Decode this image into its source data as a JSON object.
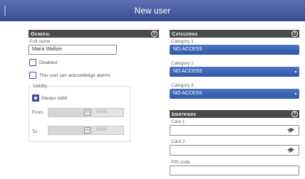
{
  "window": {
    "title": "New user"
  },
  "general": {
    "header": "General",
    "full_name_label": "Full name",
    "full_name_value": "Maria Wallser",
    "disabled_label": "Disabled",
    "disabled_checked": false,
    "acknowledge_label": "This user can acknowledge alarms",
    "acknowledge_checked": false,
    "validity": {
      "label": "Validity",
      "always_valid_label": "Always valid",
      "always_valid_checked": true,
      "from_label": "From",
      "from_time": "00:00",
      "to_label": "To",
      "to_time": "00:00"
    }
  },
  "categories": {
    "header": "Categories",
    "items": [
      {
        "label": "Category 1",
        "value": "NO ACCESS"
      },
      {
        "label": "Category 2",
        "value": "NO ACCESS"
      },
      {
        "label": "Category 3",
        "value": "NO ACCESS"
      }
    ]
  },
  "identifiers": {
    "header": "Identifiers",
    "card1_label": "Card 1",
    "card1_value": "",
    "card2_label": "Card 2",
    "card2_value": "",
    "pin_label": "PIN code",
    "pin_value": ""
  },
  "icons": {
    "help": "help-icon",
    "calendar": "calendar-icon",
    "card_reader": "card-reader-icon"
  },
  "colors": {
    "titlebar": "#3a4c92",
    "select": "#2e56a8",
    "section_header": "#4a4a4a"
  }
}
